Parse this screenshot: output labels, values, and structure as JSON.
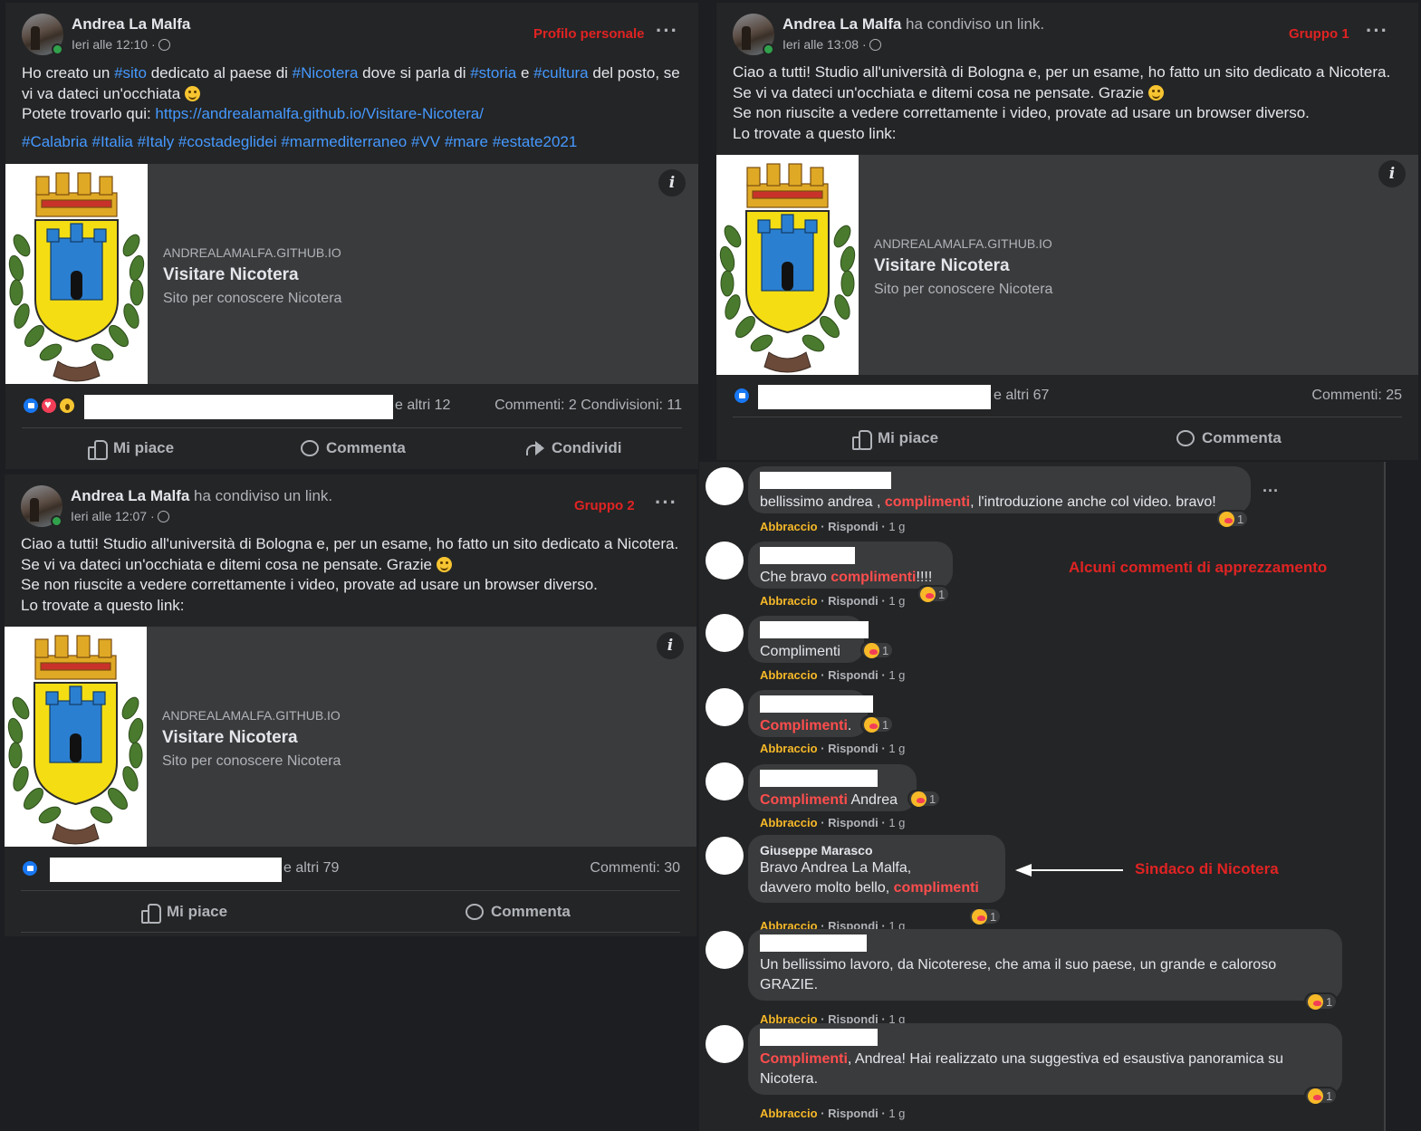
{
  "posts": [
    {
      "author": "Andrea La Malfa",
      "action": "",
      "time": "Ieri alle 12:10 ·",
      "tag": "Profilo personale",
      "text_parts": {
        "a": "Ho creato un ",
        "b": "#sito",
        "c": " dedicato al paese di ",
        "d": "#Nicotera",
        "e": " dove si parla di ",
        "f": "#storia",
        "g": " e ",
        "h": "#cultura",
        "i": " del posto, se vi va dateci un'occhiata",
        "j": "Potete trovarlo qui: ",
        "k": "https://andrealamalfa.github.io/Visitare-Nicotera/",
        "tags": "#Calabria #Italia #Italy #costadeglidei #marmediterraneo #VV #mare #estate2021"
      },
      "card": {
        "domain": "ANDREALAMALFA.GITHUB.IO",
        "title": "Visitare Nicotera",
        "desc": "Sito per conoscere Nicotera"
      },
      "others": "e altri 12",
      "counts": "Commenti: 2  Condivisioni: 11",
      "actions": {
        "like": "Mi piace",
        "comment": "Commenta",
        "share": "Condividi"
      }
    },
    {
      "author": "Andrea La Malfa",
      "action": " ha condiviso un link.",
      "time": "Ieri alle 13:08 ·",
      "tag": "Gruppo 1",
      "text_lines": [
        "Ciao a tutti! Studio all'università di Bologna e, per un esame, ho fatto un sito dedicato a Nicotera.",
        "Se vi va dateci un'occhiata e ditemi cosa ne pensate. Grazie",
        "Se non riuscite a vedere correttamente i video, provate ad usare un browser diverso.",
        "Lo trovate a questo link:"
      ],
      "card": {
        "domain": "ANDREALAMALFA.GITHUB.IO",
        "title": "Visitare Nicotera",
        "desc": "Sito per conoscere Nicotera"
      },
      "others": "e altri 67",
      "counts": "Commenti: 25",
      "actions": {
        "like": "Mi piace",
        "comment": "Commenta"
      }
    },
    {
      "author": "Andrea La Malfa",
      "action": " ha condiviso un link.",
      "time": "Ieri alle 12:07 ·",
      "tag": "Gruppo 2",
      "text_lines": [
        "Ciao a tutti! Studio all'università di Bologna e, per un esame, ho fatto un sito dedicato a Nicotera.",
        "Se vi va dateci un'occhiata e ditemi cosa ne pensate. Grazie",
        "Se non riuscite a vedere correttamente i video, provate ad usare un browser diverso.",
        "Lo trovate a questo link:"
      ],
      "card": {
        "domain": "ANDREALAMALFA.GITHUB.IO",
        "title": "Visitare Nicotera",
        "desc": "Sito per conoscere Nicotera"
      },
      "others": "e altri 79",
      "counts": "Commenti: 30",
      "actions": {
        "like": "Mi piace",
        "comment": "Commenta"
      }
    }
  ],
  "comments": [
    {
      "pre": "bellissimo andrea , ",
      "hl": "complimenti",
      "post": ", l'introduzione anche col video. bravo!",
      "reacts": "1",
      "more": "···"
    },
    {
      "pre": "Che bravo ",
      "hl": "complimenti",
      "post": "!!!!",
      "reacts": "1"
    },
    {
      "pre": "Complimenti",
      "hl": "",
      "post": "",
      "reacts": "1"
    },
    {
      "pre": "",
      "hl": "Complimenti",
      "post": ".",
      "reacts": "1"
    },
    {
      "pre": "",
      "hl": "Complimenti",
      "post": " Andrea",
      "reacts": "1"
    },
    {
      "author": "Giuseppe Marasco",
      "line1": "Bravo Andrea La Malfa,",
      "pre": "davvero molto bello, ",
      "hl": "complimenti",
      "post": "",
      "reacts": "1"
    },
    {
      "pre": "Un bellissimo lavoro, da Nicoterese, che ama il suo paese, un grande e caloroso GRAZIE.",
      "hl": "",
      "post": "",
      "reacts": "1"
    },
    {
      "pre": "",
      "hl": "Complimenti",
      "post": ", Andrea! Hai realizzato una suggestiva ed esaustiva panoramica su Nicotera.",
      "reacts": "1"
    }
  ],
  "comment_actions": {
    "hug": "Abbraccio",
    "reply": "Rispondi",
    "age": "1 g"
  },
  "annotations": {
    "appreciation": "Alcuni commenti di apprezzamento",
    "mayor": "Sindaco di Nicotera"
  },
  "colors": {
    "accent_red": "#e02323",
    "link_blue": "#4599ff",
    "hug_yellow": "#f7b928",
    "bg": "#242526"
  }
}
